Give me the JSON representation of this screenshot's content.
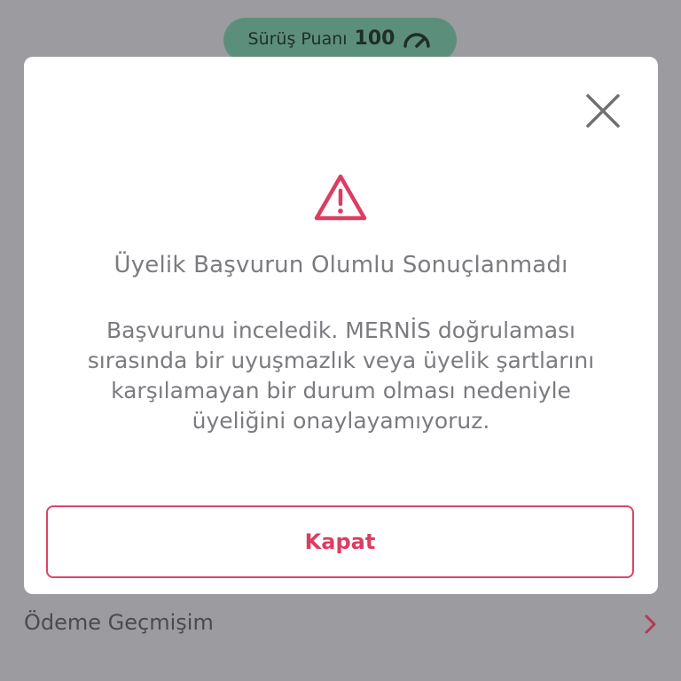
{
  "header": {
    "score_label": "Sürüş Puanı",
    "score_value": "100",
    "score_icon": "speedometer-icon"
  },
  "background_list": {
    "item_label": "Ödeme Geçmişim",
    "item_icon": "chevron-right-icon"
  },
  "dialog": {
    "close_icon": "close-icon",
    "warning_icon": "warning-triangle-icon",
    "title": "Üyelik Başvurun Olumlu Sonuçlanmadı",
    "body_lines": [
      "Başvurunu inceledik. MERNİS doğrulaması",
      "sırasında bir uyuşmazlık veya üyelik şartlarını",
      "karşılamayan bir durum olması nedeniyle",
      "üyeliğini onaylayamıyoruz."
    ],
    "button_label": "Kapat"
  },
  "colors": {
    "overlay": "#9b9ba0",
    "accent": "#dc3d62",
    "pill": "#5c8f7b",
    "text_muted": "#7b7b80"
  }
}
